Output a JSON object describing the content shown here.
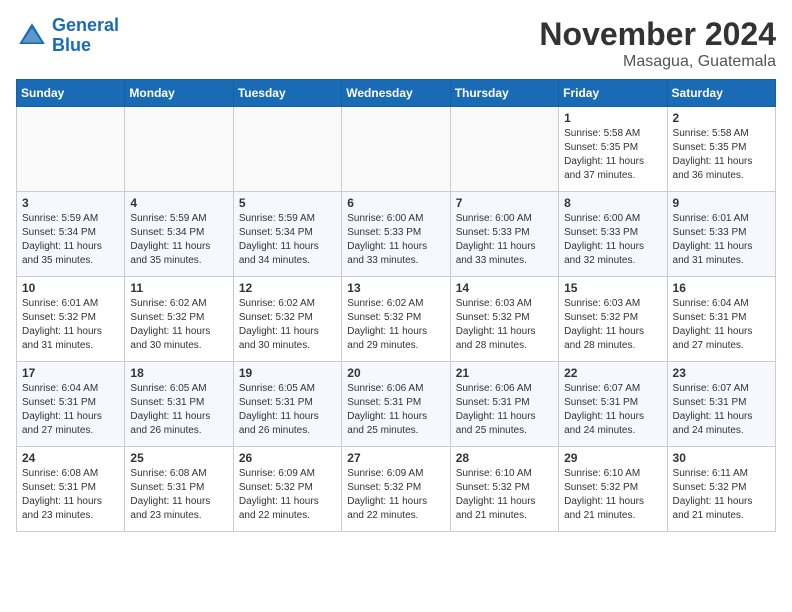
{
  "header": {
    "logo_line1": "General",
    "logo_line2": "Blue",
    "month": "November 2024",
    "location": "Masagua, Guatemala"
  },
  "weekdays": [
    "Sunday",
    "Monday",
    "Tuesday",
    "Wednesday",
    "Thursday",
    "Friday",
    "Saturday"
  ],
  "weeks": [
    [
      {
        "day": "",
        "info": ""
      },
      {
        "day": "",
        "info": ""
      },
      {
        "day": "",
        "info": ""
      },
      {
        "day": "",
        "info": ""
      },
      {
        "day": "",
        "info": ""
      },
      {
        "day": "1",
        "info": "Sunrise: 5:58 AM\nSunset: 5:35 PM\nDaylight: 11 hours\nand 37 minutes."
      },
      {
        "day": "2",
        "info": "Sunrise: 5:58 AM\nSunset: 5:35 PM\nDaylight: 11 hours\nand 36 minutes."
      }
    ],
    [
      {
        "day": "3",
        "info": "Sunrise: 5:59 AM\nSunset: 5:34 PM\nDaylight: 11 hours\nand 35 minutes."
      },
      {
        "day": "4",
        "info": "Sunrise: 5:59 AM\nSunset: 5:34 PM\nDaylight: 11 hours\nand 35 minutes."
      },
      {
        "day": "5",
        "info": "Sunrise: 5:59 AM\nSunset: 5:34 PM\nDaylight: 11 hours\nand 34 minutes."
      },
      {
        "day": "6",
        "info": "Sunrise: 6:00 AM\nSunset: 5:33 PM\nDaylight: 11 hours\nand 33 minutes."
      },
      {
        "day": "7",
        "info": "Sunrise: 6:00 AM\nSunset: 5:33 PM\nDaylight: 11 hours\nand 33 minutes."
      },
      {
        "day": "8",
        "info": "Sunrise: 6:00 AM\nSunset: 5:33 PM\nDaylight: 11 hours\nand 32 minutes."
      },
      {
        "day": "9",
        "info": "Sunrise: 6:01 AM\nSunset: 5:33 PM\nDaylight: 11 hours\nand 31 minutes."
      }
    ],
    [
      {
        "day": "10",
        "info": "Sunrise: 6:01 AM\nSunset: 5:32 PM\nDaylight: 11 hours\nand 31 minutes."
      },
      {
        "day": "11",
        "info": "Sunrise: 6:02 AM\nSunset: 5:32 PM\nDaylight: 11 hours\nand 30 minutes."
      },
      {
        "day": "12",
        "info": "Sunrise: 6:02 AM\nSunset: 5:32 PM\nDaylight: 11 hours\nand 30 minutes."
      },
      {
        "day": "13",
        "info": "Sunrise: 6:02 AM\nSunset: 5:32 PM\nDaylight: 11 hours\nand 29 minutes."
      },
      {
        "day": "14",
        "info": "Sunrise: 6:03 AM\nSunset: 5:32 PM\nDaylight: 11 hours\nand 28 minutes."
      },
      {
        "day": "15",
        "info": "Sunrise: 6:03 AM\nSunset: 5:32 PM\nDaylight: 11 hours\nand 28 minutes."
      },
      {
        "day": "16",
        "info": "Sunrise: 6:04 AM\nSunset: 5:31 PM\nDaylight: 11 hours\nand 27 minutes."
      }
    ],
    [
      {
        "day": "17",
        "info": "Sunrise: 6:04 AM\nSunset: 5:31 PM\nDaylight: 11 hours\nand 27 minutes."
      },
      {
        "day": "18",
        "info": "Sunrise: 6:05 AM\nSunset: 5:31 PM\nDaylight: 11 hours\nand 26 minutes."
      },
      {
        "day": "19",
        "info": "Sunrise: 6:05 AM\nSunset: 5:31 PM\nDaylight: 11 hours\nand 26 minutes."
      },
      {
        "day": "20",
        "info": "Sunrise: 6:06 AM\nSunset: 5:31 PM\nDaylight: 11 hours\nand 25 minutes."
      },
      {
        "day": "21",
        "info": "Sunrise: 6:06 AM\nSunset: 5:31 PM\nDaylight: 11 hours\nand 25 minutes."
      },
      {
        "day": "22",
        "info": "Sunrise: 6:07 AM\nSunset: 5:31 PM\nDaylight: 11 hours\nand 24 minutes."
      },
      {
        "day": "23",
        "info": "Sunrise: 6:07 AM\nSunset: 5:31 PM\nDaylight: 11 hours\nand 24 minutes."
      }
    ],
    [
      {
        "day": "24",
        "info": "Sunrise: 6:08 AM\nSunset: 5:31 PM\nDaylight: 11 hours\nand 23 minutes."
      },
      {
        "day": "25",
        "info": "Sunrise: 6:08 AM\nSunset: 5:31 PM\nDaylight: 11 hours\nand 23 minutes."
      },
      {
        "day": "26",
        "info": "Sunrise: 6:09 AM\nSunset: 5:32 PM\nDaylight: 11 hours\nand 22 minutes."
      },
      {
        "day": "27",
        "info": "Sunrise: 6:09 AM\nSunset: 5:32 PM\nDaylight: 11 hours\nand 22 minutes."
      },
      {
        "day": "28",
        "info": "Sunrise: 6:10 AM\nSunset: 5:32 PM\nDaylight: 11 hours\nand 21 minutes."
      },
      {
        "day": "29",
        "info": "Sunrise: 6:10 AM\nSunset: 5:32 PM\nDaylight: 11 hours\nand 21 minutes."
      },
      {
        "day": "30",
        "info": "Sunrise: 6:11 AM\nSunset: 5:32 PM\nDaylight: 11 hours\nand 21 minutes."
      }
    ]
  ]
}
